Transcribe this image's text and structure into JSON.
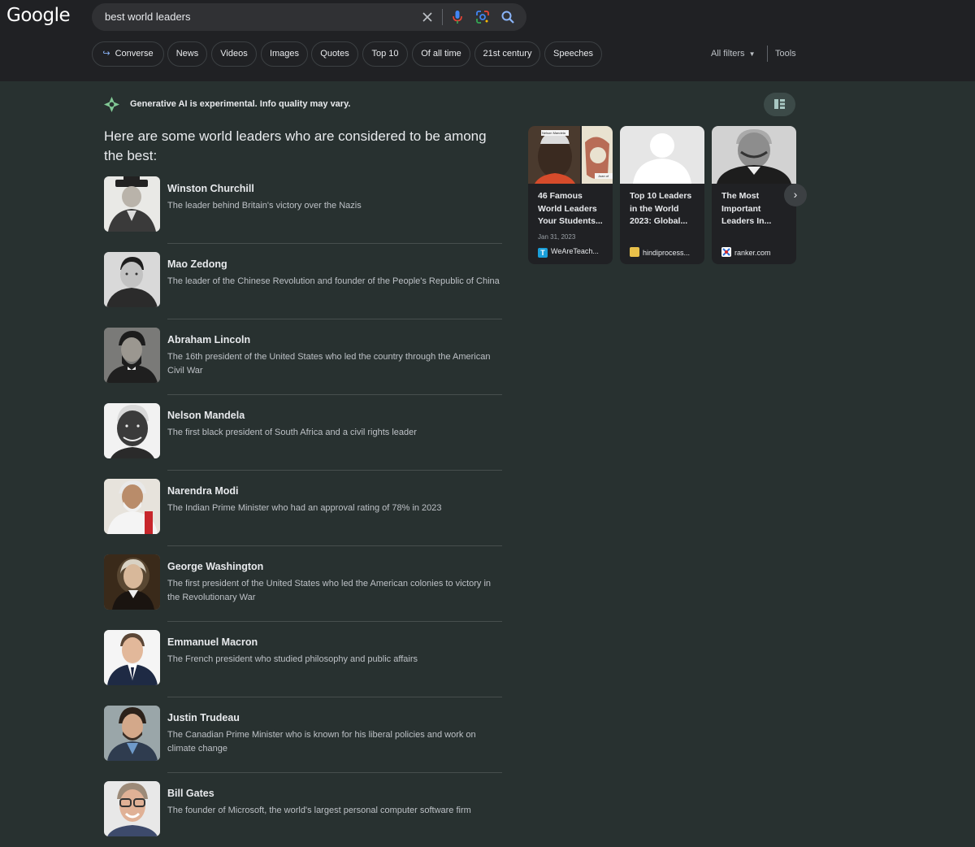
{
  "header": {
    "logo": "Google",
    "search_query": "best world leaders"
  },
  "chips": [
    {
      "label": "Converse",
      "icon": "arrow-subdirectory-icon"
    },
    {
      "label": "News"
    },
    {
      "label": "Videos"
    },
    {
      "label": "Images"
    },
    {
      "label": "Quotes"
    },
    {
      "label": "Top 10"
    },
    {
      "label": "Of all time"
    },
    {
      "label": "21st century"
    },
    {
      "label": "Speeches"
    }
  ],
  "filters": {
    "all_filters": "All filters",
    "tools": "Tools"
  },
  "ai": {
    "notice": "Generative AI is experimental. Info quality may vary.",
    "headline": "Here are some world leaders who are considered to be among the best:"
  },
  "leaders": [
    {
      "name": "Winston Churchill",
      "desc": "The leader behind Britain's victory over the Nazis"
    },
    {
      "name": "Mao Zedong",
      "desc": "The leader of the Chinese Revolution and founder of the People's Republic of China"
    },
    {
      "name": "Abraham Lincoln",
      "desc": "The 16th president of the United States who led the country through the American Civil War"
    },
    {
      "name": "Nelson Mandela",
      "desc": "The first black president of South Africa and a civil rights leader"
    },
    {
      "name": "Narendra Modi",
      "desc": "The Indian Prime Minister who had an approval rating of 78% in 2023"
    },
    {
      "name": "George Washington",
      "desc": "The first president of the United States who led the American colonies to victory in the Revolutionary War"
    },
    {
      "name": "Emmanuel Macron",
      "desc": "The French president who studied philosophy and public affairs"
    },
    {
      "name": "Justin Trudeau",
      "desc": "The Canadian Prime Minister who is known for his liberal policies and work on climate change"
    },
    {
      "name": "Bill Gates",
      "desc": "The founder of Microsoft, the world's largest personal computer software firm"
    }
  ],
  "cards": [
    {
      "title": "46 Famous World Leaders Your Students...",
      "date": "Jan 31, 2023",
      "source": "WeAreTeach...",
      "thumb_label": "Nelson Mandela",
      "thumb_label2": "Joan of",
      "favicon_color": "#1a9fd9",
      "favicon_text": "T"
    },
    {
      "title": "Top 10 Leaders in the World 2023: Global...",
      "date": "",
      "source": "hindiprocess...",
      "favicon_color": "#e8c04a",
      "favicon_text": ""
    },
    {
      "title": "The Most Important Leaders In...",
      "date": "",
      "source": "ranker.com",
      "favicon_color": "#ffffff",
      "favicon_text": ""
    }
  ],
  "colors": {
    "accent": "#8ab4f8",
    "background": "#283130",
    "topbar": "#202124"
  }
}
